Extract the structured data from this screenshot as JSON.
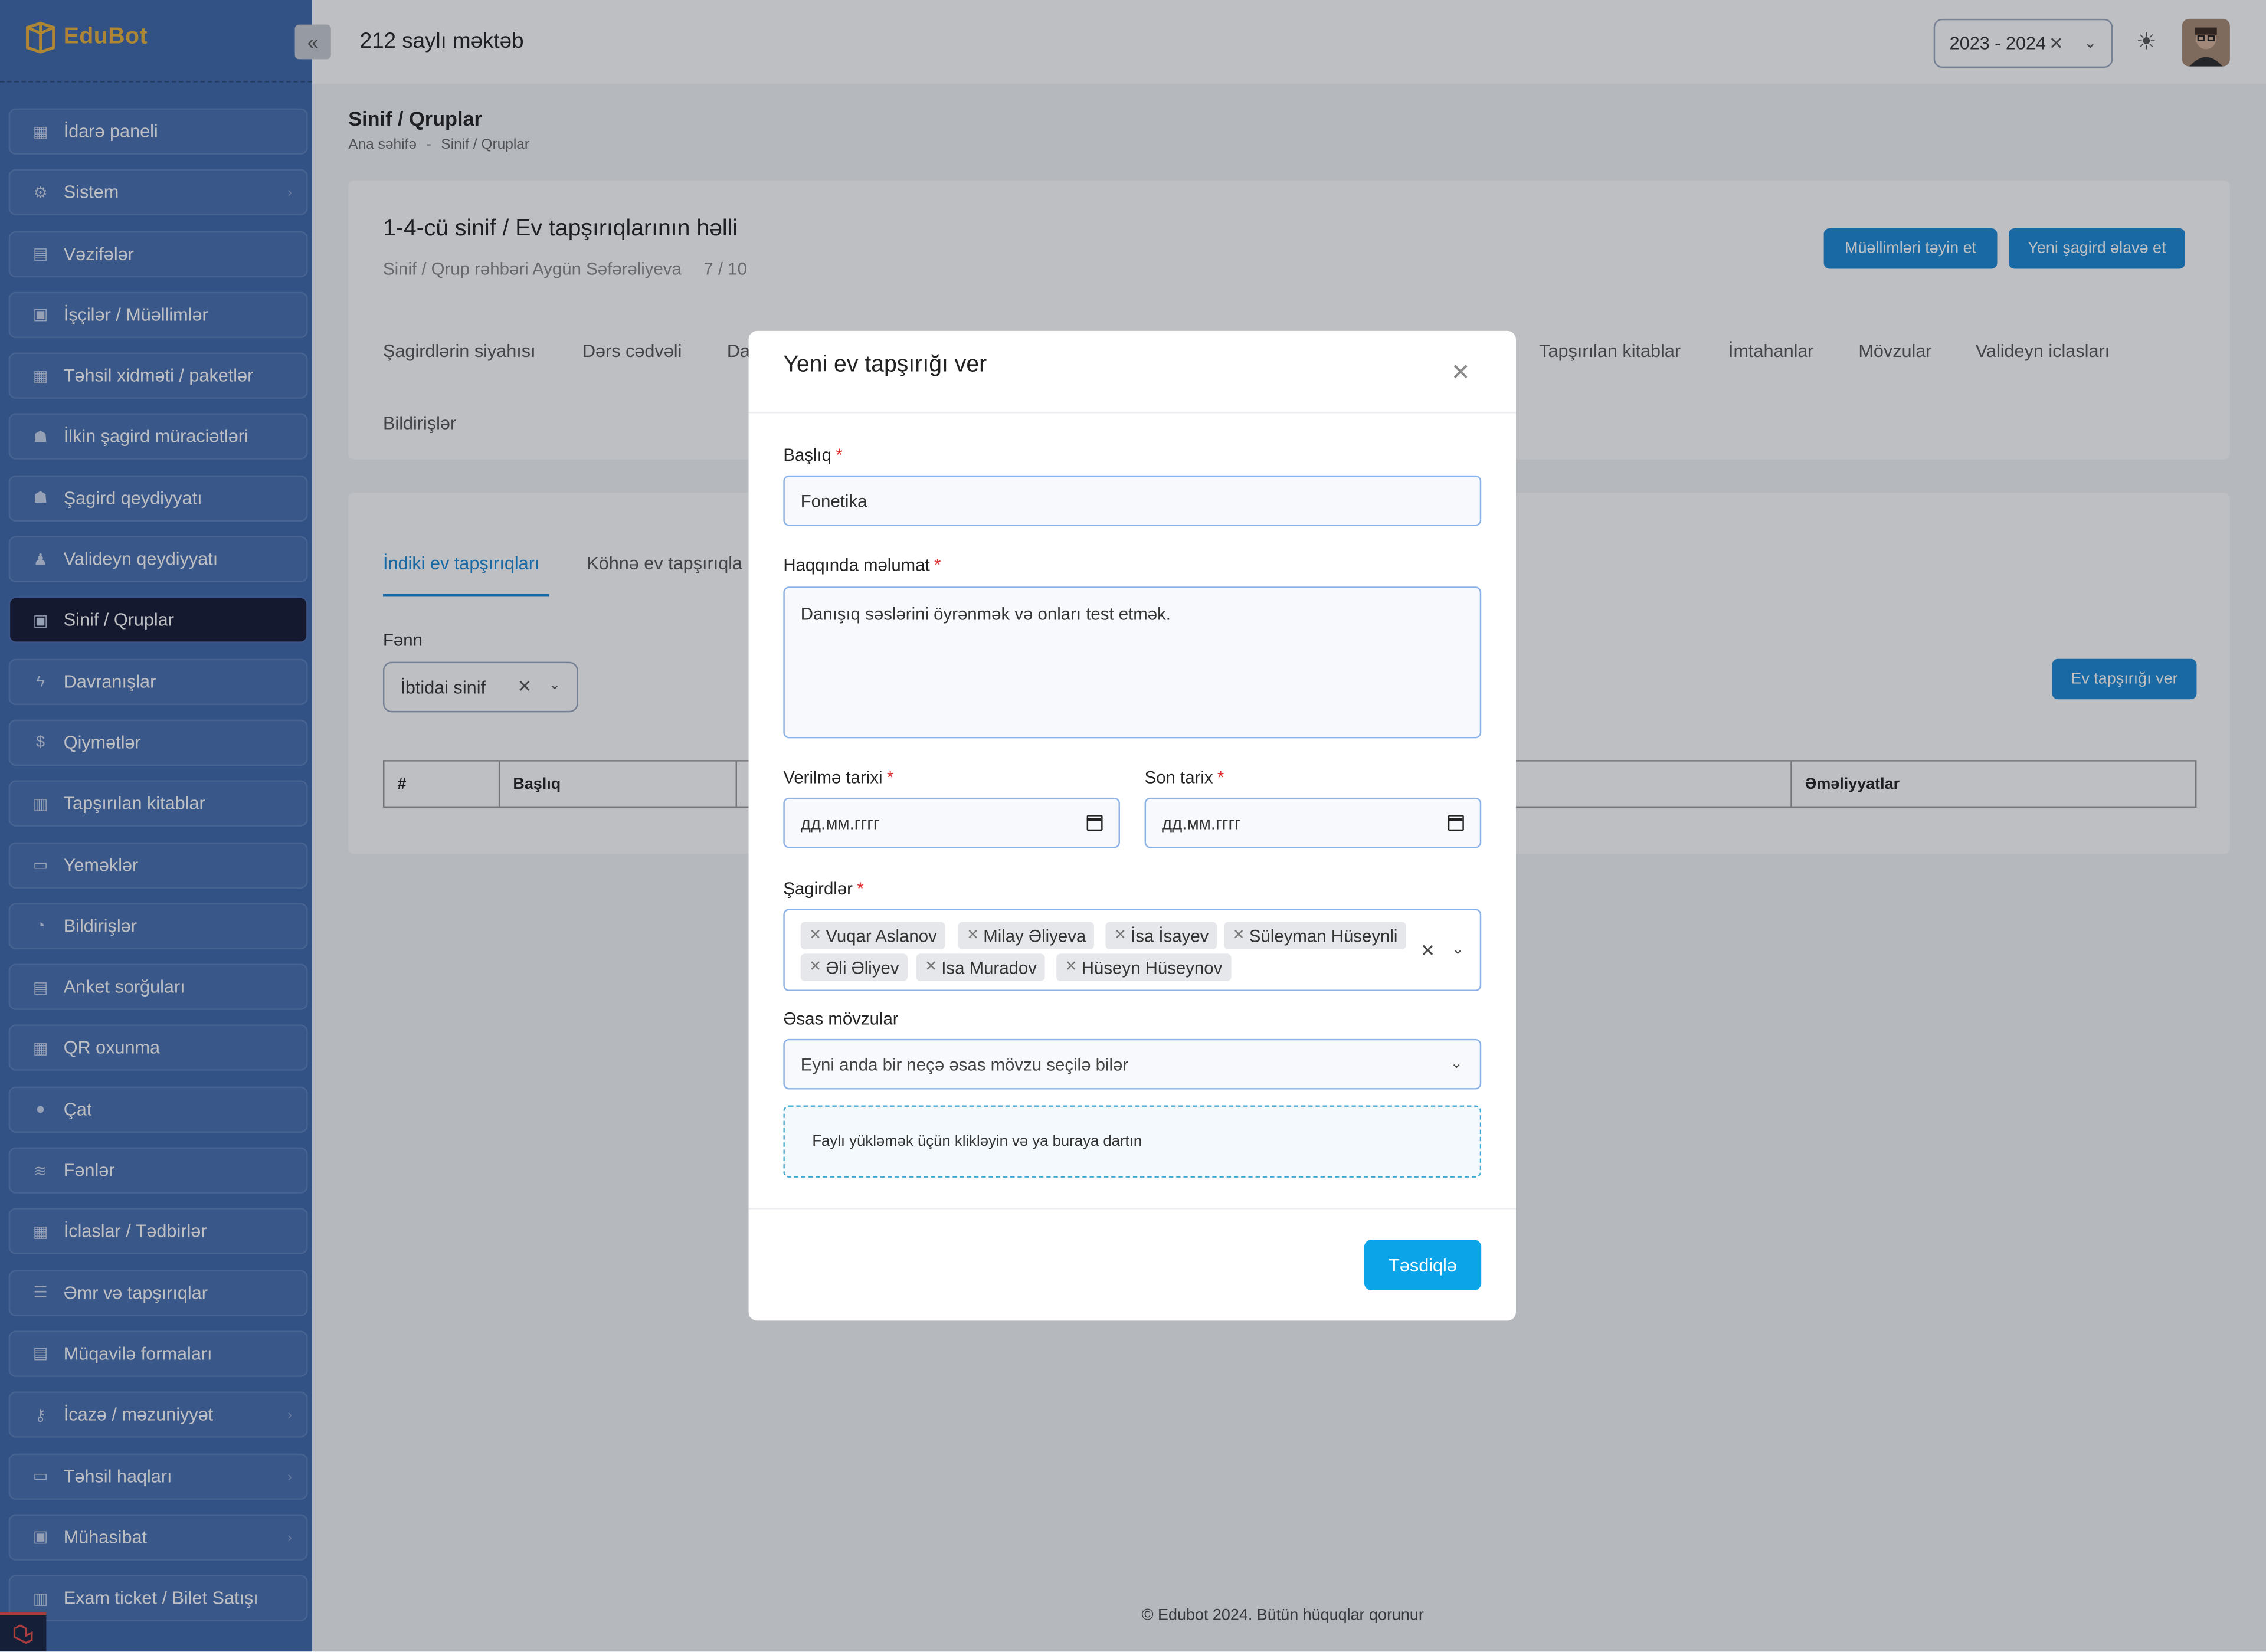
{
  "app": {
    "logo_text": "EduBot",
    "school_name": "212 saylı məktəb",
    "year": "2023 - 2024"
  },
  "sidebar": {
    "items": [
      {
        "label": "İdarə paneli",
        "icon": "dashboard-icon",
        "chevron": false
      },
      {
        "label": "Sistem",
        "icon": "gear-icon",
        "chevron": true
      },
      {
        "label": "Vəzifələr",
        "icon": "id-card-icon",
        "chevron": false
      },
      {
        "label": "İşçilər / Müəllimlər",
        "icon": "briefcase-icon",
        "chevron": false
      },
      {
        "label": "Təhsil xidməti / paketlər",
        "icon": "grid-icon",
        "chevron": false
      },
      {
        "label": "İlkin şagird müraciətləri",
        "icon": "users-icon",
        "chevron": false
      },
      {
        "label": "Şagird qeydiyyatı",
        "icon": "users-icon",
        "chevron": false
      },
      {
        "label": "Valideyn qeydiyyatı",
        "icon": "family-icon",
        "chevron": false
      },
      {
        "label": "Sinif / Qruplar",
        "icon": "contact-book-icon",
        "chevron": false,
        "active": true
      },
      {
        "label": "Davranışlar",
        "icon": "lightning-icon",
        "chevron": false
      },
      {
        "label": "Qiymətlər",
        "icon": "dollar-circle-icon",
        "chevron": false
      },
      {
        "label": "Tapşırılan kitablar",
        "icon": "books-icon",
        "chevron": false
      },
      {
        "label": "Yeməklər",
        "icon": "keyboard-icon",
        "chevron": false
      },
      {
        "label": "Bildirişlər",
        "icon": "bell-icon",
        "chevron": false
      },
      {
        "label": "Anket sorğuları",
        "icon": "clipboard-icon",
        "chevron": false
      },
      {
        "label": "QR oxunma",
        "icon": "qr-code-icon",
        "chevron": false
      },
      {
        "label": "Çat",
        "icon": "chat-icon",
        "chevron": false
      },
      {
        "label": "Fənlər",
        "icon": "layers-icon",
        "chevron": false
      },
      {
        "label": "İclaslar / Tədbirlər",
        "icon": "calendar-icon",
        "chevron": false
      },
      {
        "label": "Əmr və tapşırıqlar",
        "icon": "list-icon",
        "chevron": false
      },
      {
        "label": "Müqavilə formaları",
        "icon": "document-icon",
        "chevron": false
      },
      {
        "label": "İcazə / məzuniyyət",
        "icon": "key-icon",
        "chevron": true
      },
      {
        "label": "Təhsil haqları",
        "icon": "credit-card-icon",
        "chevron": true
      },
      {
        "label": "Mühasibat",
        "icon": "briefcase-icon",
        "chevron": true
      },
      {
        "label": "Exam ticket / Bilet Satışı",
        "icon": "books-icon",
        "chevron": false
      }
    ]
  },
  "page": {
    "title": "Sinif / Qruplar",
    "breadcrumb_home": "Ana səhifə",
    "breadcrumb_sep": "-",
    "breadcrumb_current": "Sinif / Qruplar",
    "card_title": "1-4-cü sinif / Ev tapşırıqlarının həlli",
    "card_subtitle": "Sinif / Qrup rəhbəri Aygün Səfərəliyeva",
    "card_count": "7 / 10",
    "btn_assign_teachers": "Müəllimləri təyin et",
    "btn_add_student": "Yeni şagird əlavə et",
    "tabs": [
      "Şagirdlərin siyahısı",
      "Dərs cədvəli",
      "Da",
      "Tapşırılan kitablar",
      "İmtahanlar",
      "Mövzular",
      "Valideyn iclasları",
      "Bildirişlər"
    ],
    "hw_tab_current": "İndiki ev tapşırıqları",
    "hw_tab_old": "Köhnə ev tapşırıqla",
    "subject_label": "Fənn",
    "subject_value": "İbtidai sinif",
    "btn_give_homework": "Ev tapşırığı ver",
    "table_headers": [
      "#",
      "Başlıq",
      "Əməliyyatlar"
    ]
  },
  "footer": {
    "text": "© Edubot 2024. Bütün hüquqlar qorunur"
  },
  "modal": {
    "title": "Yeni ev tapşırığı ver",
    "title_label": "Başlıq",
    "title_value": "Fonetika",
    "info_label": "Haqqında məlumat",
    "info_value": "Danışıq səslərini öyrənmək və onları test etmək.",
    "given_date_label": "Verilmə tarixi",
    "given_date_value": "дд.мм.гггг",
    "due_date_label": "Son tarix",
    "due_date_value": "дд.мм.гггг",
    "students_label": "Şagirdlər",
    "students": [
      "Vuqar Aslanov",
      "Milay Əliyeva",
      "İsa İsayev",
      "Süleyman Hüseynli",
      "Əli Əliyev",
      "Isa Muradov",
      "Hüseyn Hüseynov"
    ],
    "topics_label": "Əsas mövzular",
    "topics_placeholder": "Eyni anda bir neçə əsas mövzu seçilə bilər",
    "upload_text": "Faylı yükləmək üçün klikləyin və ya buraya dartın",
    "submit_label": "Təsdiqlə",
    "required_mark": "*"
  },
  "colors": {
    "sidebar_bg": "#3e67aa",
    "active_bg": "#141a35",
    "primary": "#1a88d6",
    "submit": "#0ba4e9",
    "logo": "#e9b23c"
  }
}
